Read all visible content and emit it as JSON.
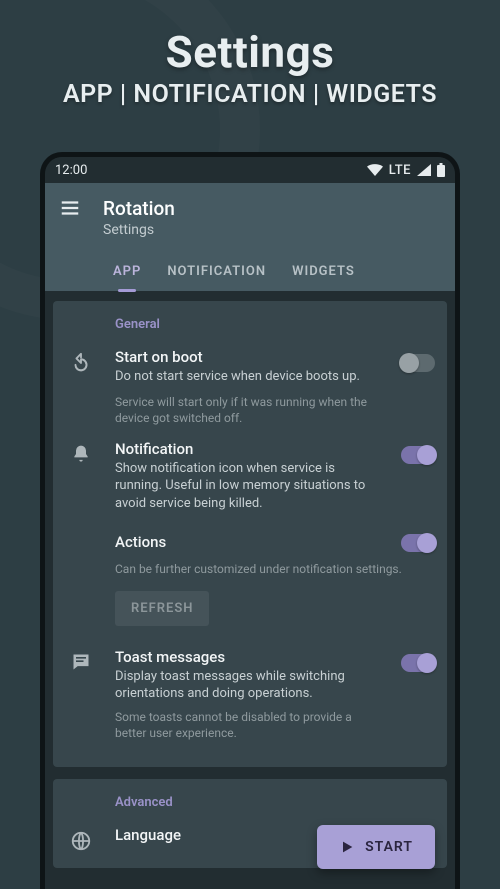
{
  "hero": {
    "title": "Settings",
    "subtitle": "APP | NOTIFICATION | WIDGETS"
  },
  "status": {
    "time": "12:00",
    "network": "LTE"
  },
  "header": {
    "app_title": "Rotation",
    "app_subtitle": "Settings"
  },
  "tabs": {
    "app": "APP",
    "notification": "NOTIFICATION",
    "widgets": "WIDGETS",
    "active": "app"
  },
  "sections": {
    "general": {
      "label": "General",
      "start_on_boot": {
        "title": "Start on boot",
        "desc": "Do not start service when device boots up.",
        "hint": "Service will start only if it was running when the device got switched off.",
        "enabled": false
      },
      "notification": {
        "title": "Notification",
        "desc": "Show notification icon when service is running. Useful in low memory situations to avoid service being killed.",
        "enabled": true
      },
      "actions": {
        "title": "Actions",
        "hint": "Can be further customized under notification settings.",
        "enabled": true
      },
      "refresh_label": "REFRESH",
      "toast": {
        "title": "Toast messages",
        "desc": "Display toast messages while switching orientations and doing operations.",
        "hint": "Some toasts cannot be disabled to provide a better user experience.",
        "enabled": true
      }
    },
    "advanced": {
      "label": "Advanced",
      "language": {
        "title": "Language"
      }
    }
  },
  "fab": {
    "label": "START"
  }
}
